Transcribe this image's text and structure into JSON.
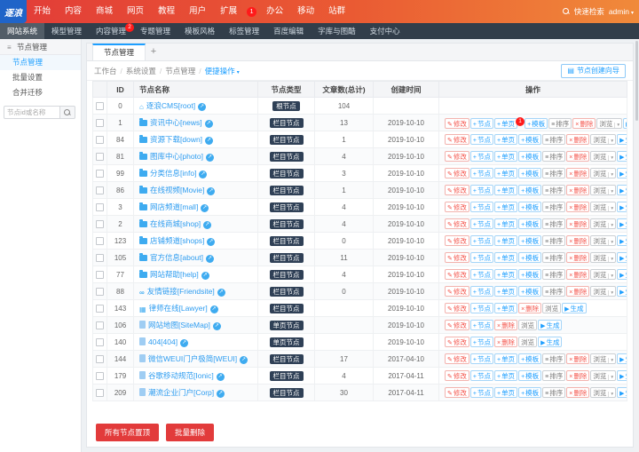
{
  "topbar": {
    "logo_text": "逐浪",
    "menus": [
      "开始",
      "内容",
      "商城",
      "网页",
      "教程",
      "用户",
      "扩展"
    ],
    "notice_badge": "1",
    "menus_right": [
      "办公",
      "移动",
      "站群"
    ],
    "quick_search": "快速检索",
    "user": "admin"
  },
  "subnav": {
    "items": [
      {
        "label": "网站系统",
        "active": true,
        "badge": ""
      },
      {
        "label": "模型管理",
        "active": false,
        "badge": ""
      },
      {
        "label": "内容管理",
        "active": false,
        "badge": "2"
      },
      {
        "label": "专题管理",
        "active": false,
        "badge": ""
      },
      {
        "label": "模板风格",
        "active": false,
        "badge": ""
      },
      {
        "label": "标签管理",
        "active": false,
        "badge": ""
      },
      {
        "label": "百度编辑",
        "active": false,
        "badge": ""
      },
      {
        "label": "字库与图酷",
        "active": false,
        "badge": ""
      },
      {
        "label": "支付中心",
        "active": false,
        "badge": ""
      }
    ]
  },
  "sidebar": {
    "title": "节点管理",
    "items": [
      {
        "label": "节点管理",
        "active": true
      },
      {
        "label": "批量设置",
        "active": false
      },
      {
        "label": "合并迁移",
        "active": false
      }
    ],
    "search_placeholder": "节点id或名称"
  },
  "main": {
    "tab": "节点管理",
    "tab_add": "+",
    "breadcrumb": [
      "工作台",
      "系统设置",
      "节点管理"
    ],
    "breadcrumb_action": "便捷操作",
    "wizard_button": "节点创建向导",
    "footer_buttons": [
      "所有节点置顶",
      "批量删除"
    ]
  },
  "table": {
    "headers": [
      "ID",
      "节点名称",
      "节点类型",
      "文章数(总计)",
      "创建时间",
      "操作"
    ],
    "ops_buttons": {
      "edit": {
        "label": "修改",
        "icon": "✎",
        "style": "warm"
      },
      "node": {
        "label": "节点",
        "icon": "+",
        "style": "blue"
      },
      "page": {
        "label": "单页",
        "icon": "+",
        "style": "blue"
      },
      "tpl": {
        "label": "模板",
        "icon": "+",
        "style": "blue"
      },
      "sort": {
        "label": "排序",
        "icon": "≡",
        "style": "plain"
      },
      "del": {
        "label": "删除",
        "icon": "×",
        "style": "warm"
      },
      "view": {
        "label": "浏览",
        "icon": "",
        "style": "plain",
        "caret": true
      },
      "viewp": {
        "label": "浏览",
        "icon": "",
        "style": "plain"
      },
      "gen": {
        "label": "生成",
        "icon": "▶",
        "style": "blue"
      }
    },
    "ops_sets": {
      "full": [
        "edit",
        "node",
        "page",
        "tpl",
        "sort",
        "del",
        "view",
        "gen"
      ],
      "mid": [
        "edit",
        "node",
        "page",
        "del",
        "viewp",
        "gen"
      ],
      "single": [
        "edit",
        "node",
        "del",
        "viewp",
        "gen"
      ],
      "none": []
    },
    "rows": [
      {
        "id": "0",
        "name": "逐浪CMS[root]",
        "icon": "home",
        "type": "根节点",
        "count": "104",
        "date": "",
        "ops": "none",
        "badge": ""
      },
      {
        "id": "1",
        "name": "资讯中心[news]",
        "icon": "folder",
        "type": "栏目节点",
        "count": "13",
        "date": "2019-10-10",
        "ops": "full",
        "badge": "1"
      },
      {
        "id": "84",
        "name": "资源下载[down]",
        "icon": "folder",
        "type": "栏目节点",
        "count": "1",
        "date": "2019-10-10",
        "ops": "full",
        "badge": ""
      },
      {
        "id": "81",
        "name": "图库中心[photo]",
        "icon": "folder",
        "type": "栏目节点",
        "count": "4",
        "date": "2019-10-10",
        "ops": "full",
        "badge": ""
      },
      {
        "id": "99",
        "name": "分类信息[info]",
        "icon": "folder",
        "type": "栏目节点",
        "count": "3",
        "date": "2019-10-10",
        "ops": "full",
        "badge": ""
      },
      {
        "id": "86",
        "name": "在线视频[Movie]",
        "icon": "folder",
        "type": "栏目节点",
        "count": "1",
        "date": "2019-10-10",
        "ops": "full",
        "badge": ""
      },
      {
        "id": "3",
        "name": "网店频道[mall]",
        "icon": "folder",
        "type": "栏目节点",
        "count": "4",
        "date": "2019-10-10",
        "ops": "full",
        "badge": ""
      },
      {
        "id": "2",
        "name": "在线商城[shop]",
        "icon": "folder",
        "type": "栏目节点",
        "count": "4",
        "date": "2019-10-10",
        "ops": "full",
        "badge": ""
      },
      {
        "id": "123",
        "name": "店铺频道[shops]",
        "icon": "folder",
        "type": "栏目节点",
        "count": "0",
        "date": "2019-10-10",
        "ops": "full",
        "badge": ""
      },
      {
        "id": "105",
        "name": "官方信息[about]",
        "icon": "folder",
        "type": "栏目节点",
        "count": "11",
        "date": "2019-10-10",
        "ops": "full",
        "badge": ""
      },
      {
        "id": "77",
        "name": "网站帮助[help]",
        "icon": "folder",
        "type": "栏目节点",
        "count": "4",
        "date": "2019-10-10",
        "ops": "full",
        "badge": ""
      },
      {
        "id": "88",
        "name": "友情链接[Friendsite]",
        "icon": "link",
        "type": "栏目节点",
        "count": "0",
        "date": "2019-10-10",
        "ops": "full",
        "badge": ""
      },
      {
        "id": "143",
        "name": "律师在线[Lawyer]",
        "icon": "calendar",
        "type": "栏目节点",
        "count": "",
        "date": "2019-10-10",
        "ops": "mid",
        "badge": ""
      },
      {
        "id": "106",
        "name": "网站地图[SiteMap]",
        "icon": "file",
        "type": "单页节点",
        "count": "",
        "date": "2019-10-10",
        "ops": "single",
        "badge": ""
      },
      {
        "id": "140",
        "name": "404[404]",
        "icon": "file",
        "type": "单页节点",
        "count": "",
        "date": "2019-10-10",
        "ops": "single",
        "badge": ""
      },
      {
        "id": "144",
        "name": "微信WEUI门户极简[WEUI]",
        "icon": "file",
        "type": "栏目节点",
        "count": "17",
        "date": "2017-04-10",
        "ops": "full",
        "badge": ""
      },
      {
        "id": "179",
        "name": "谷歌移动规范[Ionic]",
        "icon": "file",
        "type": "栏目节点",
        "count": "4",
        "date": "2017-04-11",
        "ops": "full",
        "badge": ""
      },
      {
        "id": "209",
        "name": "潮流企业门户[Corp]",
        "icon": "file",
        "type": "栏目节点",
        "count": "30",
        "date": "2017-04-11",
        "ops": "full",
        "badge": ""
      }
    ]
  }
}
